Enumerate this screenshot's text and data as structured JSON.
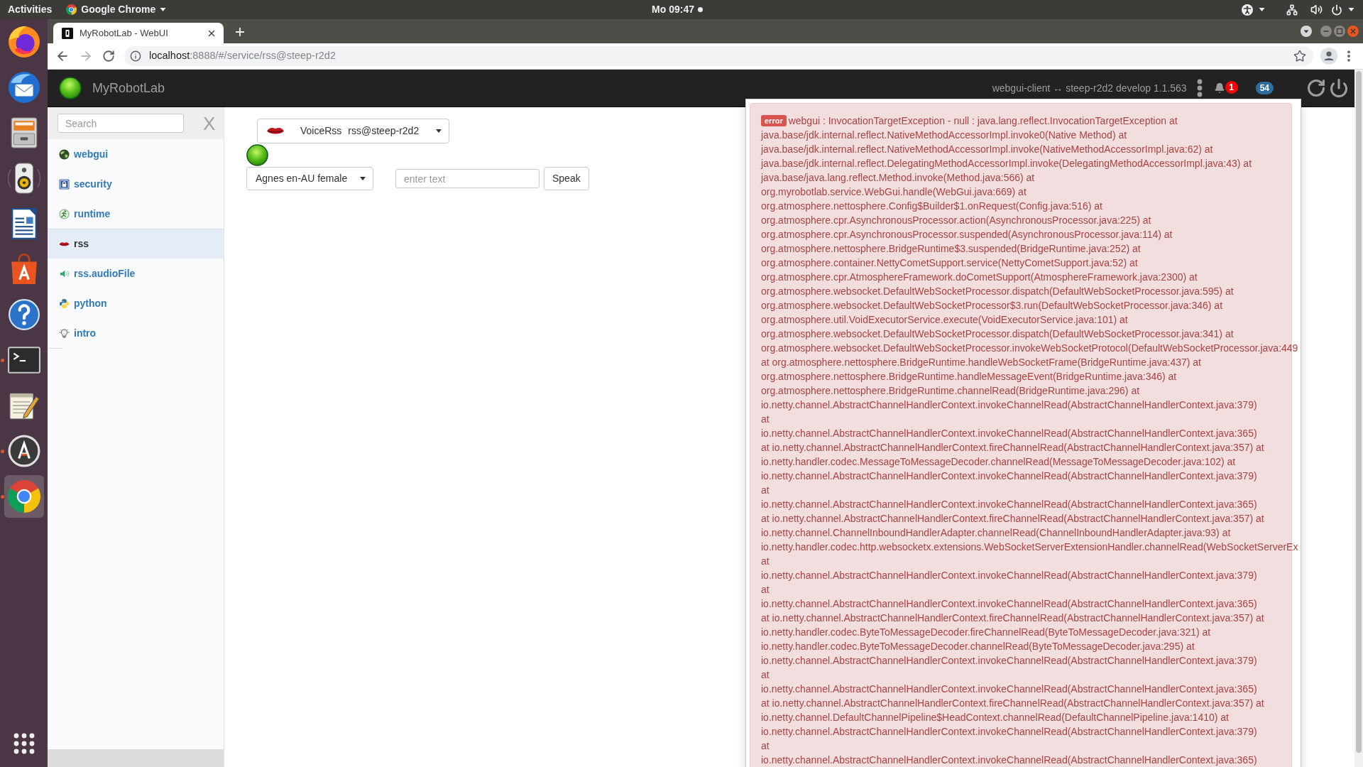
{
  "top_bar": {
    "activities": "Activities",
    "app_menu": "Google Chrome",
    "clock": "Mo 09:47"
  },
  "dock": {
    "apps": [
      {
        "running": false,
        "selected": false
      },
      {
        "running": false,
        "selected": false
      },
      {
        "running": false,
        "selected": false
      },
      {
        "running": false,
        "selected": false
      },
      {
        "running": false,
        "selected": false
      },
      {
        "running": false,
        "selected": false
      },
      {
        "running": false,
        "selected": false
      },
      {
        "running": true,
        "selected": false
      },
      {
        "running": false,
        "selected": false
      },
      {
        "running": true,
        "selected": false
      },
      {
        "running": true,
        "selected": true
      }
    ]
  },
  "browser": {
    "tabs": [
      {
        "title": "MyRobotLab - WebUI",
        "selected": true
      }
    ],
    "address_bar": {
      "host": "localhost",
      "path": ":8888/#/service/rss@steep-r2d2"
    }
  },
  "navbar": {
    "brand": "MyRobotLab",
    "connection": "webgui-client ↔ steep-r2d2 develop 1.1.563",
    "notification_count": "1",
    "message_count": "54"
  },
  "sidebar": {
    "search": {
      "placeholder": "Search"
    },
    "close": "X",
    "items": [
      {
        "label": "webgui",
        "selected": false
      },
      {
        "label": "security",
        "selected": false
      },
      {
        "label": "runtime",
        "selected": false
      },
      {
        "label": "rss",
        "selected": true
      },
      {
        "label": "rss.audioFile",
        "selected": false
      },
      {
        "label": "python",
        "selected": false
      },
      {
        "label": "intro",
        "selected": false
      }
    ]
  },
  "service": {
    "type": "VoiceRss",
    "name": "rss@steep-r2d2",
    "voice": "Agnes en-AU female",
    "text_input": {
      "placeholder": "enter text"
    },
    "speak_button": "Speak"
  },
  "notification_panel": {
    "alerts": [
      {
        "kind": "error",
        "badge": "error",
        "message": "webgui : InvocationTargetException - null : java.lang.reflect.InvocationTargetException at",
        "lines": [
          "java.base/jdk.internal.reflect.NativeMethodAccessorImpl.invoke0(Native Method) at",
          "java.base/jdk.internal.reflect.NativeMethodAccessorImpl.invoke(NativeMethodAccessorImpl.java:62) at",
          "java.base/jdk.internal.reflect.DelegatingMethodAccessorImpl.invoke(DelegatingMethodAccessorImpl.java:43) at",
          "java.base/java.lang.reflect.Method.invoke(Method.java:566) at",
          "org.myrobotlab.service.WebGui.handle(WebGui.java:669) at",
          "org.atmosphere.nettosphere.Config$Builder$1.onRequest(Config.java:516) at",
          "org.atmosphere.cpr.AsynchronousProcessor.action(AsynchronousProcessor.java:225) at",
          "org.atmosphere.cpr.AsynchronousProcessor.suspended(AsynchronousProcessor.java:114) at",
          "org.atmosphere.nettosphere.BridgeRuntime$3.suspended(BridgeRuntime.java:252) at",
          "org.atmosphere.container.NettyCometSupport.service(NettyCometSupport.java:52) at",
          "org.atmosphere.cpr.AtmosphereFramework.doCometSupport(AtmosphereFramework.java:2300) at",
          "org.atmosphere.websocket.DefaultWebSocketProcessor.dispatch(DefaultWebSocketProcessor.java:595) at",
          "org.atmosphere.websocket.DefaultWebSocketProcessor$3.run(DefaultWebSocketProcessor.java:346) at",
          "org.atmosphere.util.VoidExecutorService.execute(VoidExecutorService.java:101) at",
          "org.atmosphere.websocket.DefaultWebSocketProcessor.dispatch(DefaultWebSocketProcessor.java:341) at",
          "org.atmosphere.websocket.DefaultWebSocketProcessor.invokeWebSocketProtocol(DefaultWebSocketProcessor.java:449",
          "at org.atmosphere.nettosphere.BridgeRuntime.handleWebSocketFrame(BridgeRuntime.java:437) at",
          "org.atmosphere.nettosphere.BridgeRuntime.handleMessageEvent(BridgeRuntime.java:346) at",
          "org.atmosphere.nettosphere.BridgeRuntime.channelRead(BridgeRuntime.java:296) at",
          "io.netty.channel.AbstractChannelHandlerContext.invokeChannelRead(AbstractChannelHandlerContext.java:379)",
          "at",
          "io.netty.channel.AbstractChannelHandlerContext.invokeChannelRead(AbstractChannelHandlerContext.java:365)",
          "at io.netty.channel.AbstractChannelHandlerContext.fireChannelRead(AbstractChannelHandlerContext.java:357) at",
          "io.netty.handler.codec.MessageToMessageDecoder.channelRead(MessageToMessageDecoder.java:102) at",
          "io.netty.channel.AbstractChannelHandlerContext.invokeChannelRead(AbstractChannelHandlerContext.java:379)",
          "at",
          "io.netty.channel.AbstractChannelHandlerContext.invokeChannelRead(AbstractChannelHandlerContext.java:365)",
          "at io.netty.channel.AbstractChannelHandlerContext.fireChannelRead(AbstractChannelHandlerContext.java:357) at",
          "io.netty.channel.ChannelInboundHandlerAdapter.channelRead(ChannelInboundHandlerAdapter.java:93) at",
          "io.netty.handler.codec.http.websocketx.extensions.WebSocketServerExtensionHandler.channelRead(WebSocketServerEx",
          "at",
          "io.netty.channel.AbstractChannelHandlerContext.invokeChannelRead(AbstractChannelHandlerContext.java:379)",
          "at",
          "io.netty.channel.AbstractChannelHandlerContext.invokeChannelRead(AbstractChannelHandlerContext.java:365)",
          "at io.netty.channel.AbstractChannelHandlerContext.fireChannelRead(AbstractChannelHandlerContext.java:357) at",
          "io.netty.handler.codec.ByteToMessageDecoder.fireChannelRead(ByteToMessageDecoder.java:321) at",
          "io.netty.handler.codec.ByteToMessageDecoder.channelRead(ByteToMessageDecoder.java:295) at",
          "io.netty.channel.AbstractChannelHandlerContext.invokeChannelRead(AbstractChannelHandlerContext.java:379)",
          "at",
          "io.netty.channel.AbstractChannelHandlerContext.invokeChannelRead(AbstractChannelHandlerContext.java:365)",
          "at io.netty.channel.AbstractChannelHandlerContext.fireChannelRead(AbstractChannelHandlerContext.java:357) at",
          "io.netty.channel.DefaultChannelPipeline$HeadContext.channelRead(DefaultChannelPipeline.java:1410) at",
          "io.netty.channel.AbstractChannelHandlerContext.invokeChannelRead(AbstractChannelHandlerContext.java:379)",
          "at",
          "io.netty.channel.AbstractChannelHandlerContext.invokeChannelRead(AbstractChannelHandlerContext.java:365)"
        ]
      }
    ]
  }
}
